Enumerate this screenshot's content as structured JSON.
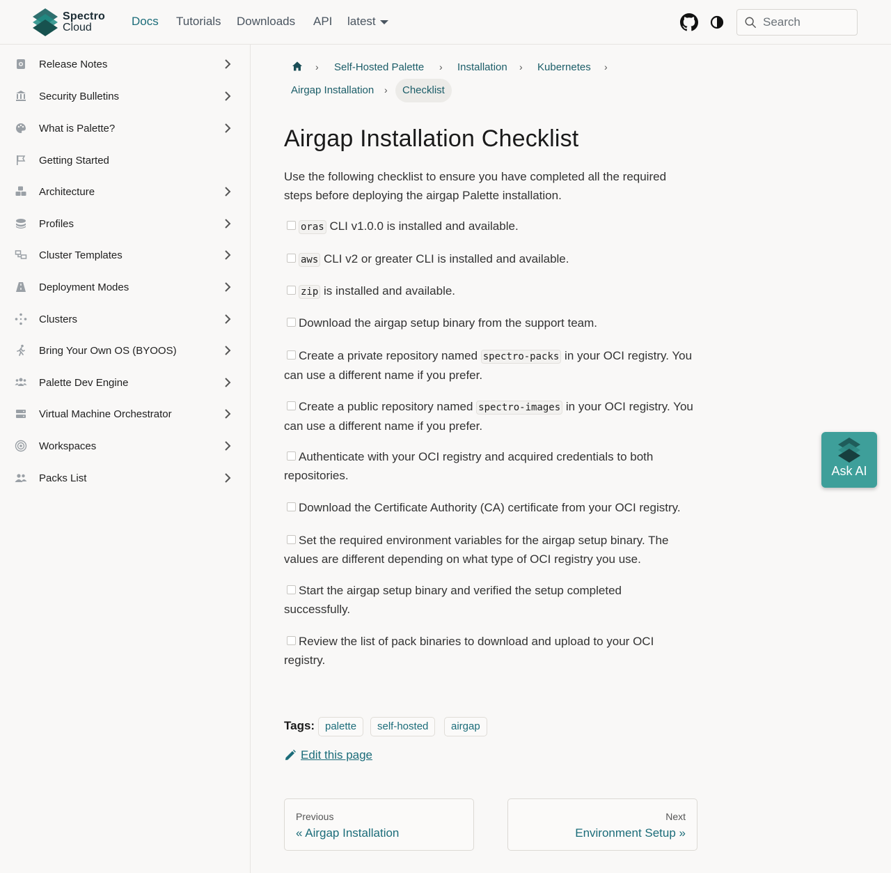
{
  "header": {
    "logo": {
      "line1": "Spectro",
      "line2": "Cloud"
    },
    "nav": [
      {
        "label": "Docs",
        "active": true
      },
      {
        "label": "Tutorials"
      },
      {
        "label": "Downloads"
      },
      {
        "label": "API"
      }
    ],
    "version": "latest",
    "search_placeholder": "Search"
  },
  "sidebar": {
    "items": [
      {
        "label": "Release Notes",
        "icon": "file-search-icon",
        "expandable": true
      },
      {
        "label": "Security Bulletins",
        "icon": "building-columns-icon",
        "expandable": true
      },
      {
        "label": "What is Palette?",
        "icon": "palette-icon",
        "expandable": true
      },
      {
        "label": "Getting Started",
        "icon": "flag-icon",
        "expandable": false
      },
      {
        "label": "Architecture",
        "icon": "cubes-icon",
        "expandable": true
      },
      {
        "label": "Profiles",
        "icon": "layers-icon",
        "expandable": true
      },
      {
        "label": "Cluster Templates",
        "icon": "template-icon",
        "expandable": true
      },
      {
        "label": "Deployment Modes",
        "icon": "road-icon",
        "expandable": true
      },
      {
        "label": "Clusters",
        "icon": "clusters-icon",
        "expandable": true
      },
      {
        "label": "Bring Your Own OS (BYOOS)",
        "icon": "person-walking-icon",
        "expandable": true
      },
      {
        "label": "Palette Dev Engine",
        "icon": "users-icon",
        "expandable": true
      },
      {
        "label": "Virtual Machine Orchestrator",
        "icon": "server-icon",
        "expandable": true
      },
      {
        "label": "Workspaces",
        "icon": "workspace-icon",
        "expandable": true
      },
      {
        "label": "Packs List",
        "icon": "user-group-icon",
        "expandable": true
      }
    ]
  },
  "breadcrumb": {
    "items": [
      "Self-Hosted Palette",
      "Installation",
      "Kubernetes",
      "Airgap Installation"
    ],
    "current": "Checklist"
  },
  "page": {
    "title": "Airgap Installation Checklist",
    "intro": "Use the following checklist to ensure you have completed all the required steps before deploying the airgap Palette installation.",
    "tasks": [
      {
        "code": "oras",
        "text_after": " CLI v1.0.0 is installed and available."
      },
      {
        "code": "aws",
        "text_after": " CLI v2 or greater CLI is installed and available."
      },
      {
        "code": "zip",
        "text_after": " is installed and available."
      },
      {
        "text_before": "Download the airgap setup binary from the support team."
      },
      {
        "text_before": "Create a private repository named ",
        "code": "spectro-packs",
        "text_after": " in your OCI registry. You can use a different name if you prefer."
      },
      {
        "text_before": "Create a public repository named ",
        "code": "spectro-images",
        "text_after": " in your OCI registry. You can use a different name if you prefer."
      },
      {
        "text_before": "Authenticate with your OCI registry and acquired credentials to both repositories."
      },
      {
        "text_before": "Download the Certificate Authority (CA) certificate from your OCI registry."
      },
      {
        "text_before": "Set the required environment variables for the airgap setup binary. The values are different depending on what type of OCI registry you use."
      },
      {
        "text_before": "Start the airgap setup binary and verified the setup completed successfully."
      },
      {
        "text_before": "Review the list of pack binaries to download and upload to your OCI registry."
      }
    ],
    "tags_label": "Tags:",
    "tags": [
      "palette",
      "self-hosted",
      "airgap"
    ],
    "edit_link": "Edit this page",
    "prev": {
      "sub": "Previous",
      "label": "« Airgap Installation"
    },
    "next": {
      "sub": "Next",
      "label": "Environment Setup »"
    }
  },
  "ask_ai": {
    "label": "Ask AI"
  },
  "colors": {
    "accent": "#1b6c79",
    "ask_ai_bg": "#3e9f9a",
    "page_bg": "#f9f8f7"
  }
}
